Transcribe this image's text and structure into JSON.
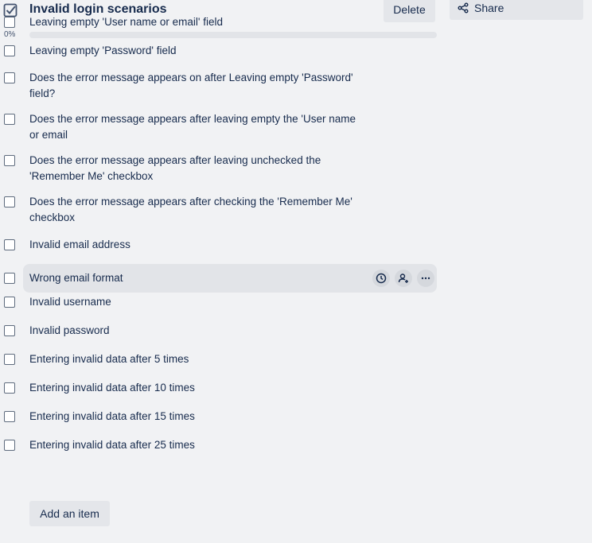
{
  "checklist": {
    "title": "Invalid login scenarios",
    "delete_label": "Delete",
    "share_label": "Share",
    "progress": {
      "percent_label": "0%",
      "value": 0
    },
    "items": [
      {
        "label": "Leaving empty 'User name or email' field",
        "checked": false
      },
      {
        "label": "Leaving empty 'Password' field",
        "checked": false
      },
      {
        "label": "Does the error message appears on after Leaving empty 'Password' field?",
        "checked": false
      },
      {
        "label": "Does the error message appears after leaving empty the 'User name or email",
        "checked": false
      },
      {
        "label": "Does the error message appears after leaving unchecked the 'Remember Me' checkbox",
        "checked": false
      },
      {
        "label": "Does the error message appears after checking the 'Remember Me' checkbox",
        "checked": false
      },
      {
        "label": "Invalid email address",
        "checked": false
      },
      {
        "label": "Wrong email format",
        "checked": false,
        "hovered": true
      },
      {
        "label": "Invalid username",
        "checked": false
      },
      {
        "label": "Invalid password",
        "checked": false
      },
      {
        "label": "Entering invalid data after 5 times",
        "checked": false
      },
      {
        "label": "Entering invalid data after 10 times",
        "checked": false
      },
      {
        "label": "Entering invalid data after 15 times",
        "checked": false
      },
      {
        "label": "Entering invalid data after 25 times",
        "checked": false
      }
    ],
    "add_item_label": "Add an item"
  },
  "icons": {
    "title": "checkbox-checked-icon",
    "share": "share-icon",
    "due": "clock-icon",
    "assign": "add-member-icon",
    "more": "more-icon"
  },
  "colors": {
    "background": "#f1f2f4",
    "button": "#e4e6ea",
    "text": "#172b4d",
    "hover": "#e2e4e8"
  }
}
